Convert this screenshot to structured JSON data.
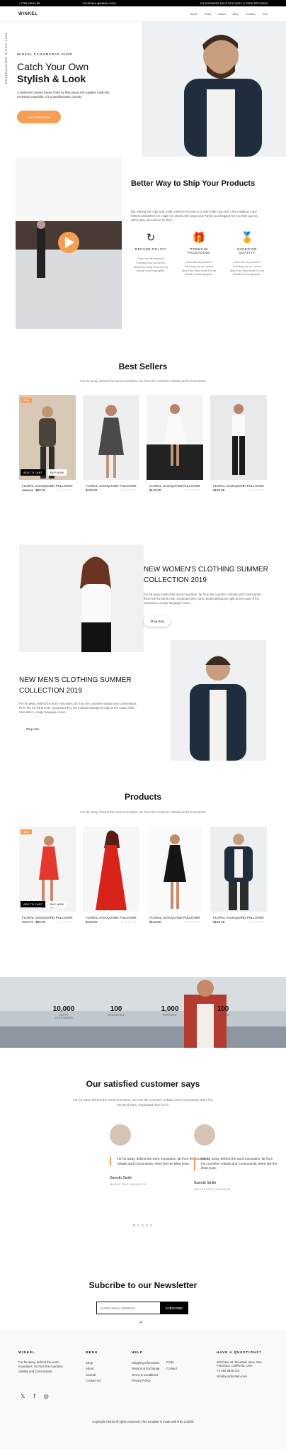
{
  "topbar": {
    "phone": "+ 2785 29910 88",
    "email": "YOURMAIL@EMAIL.COM",
    "offer": "3-5 BUSINESS DAYS DELIVERY & FREE RETURNS"
  },
  "nav": {
    "logo": "WINKEL",
    "items": [
      "Home",
      "Shop",
      "About",
      "Blog",
      "Contact",
      "Cart"
    ]
  },
  "hero": {
    "eyebrow": "WINKEL ECOMMERCE SHOP",
    "title1": "Catch Your Own",
    "title2": "Stylish & Look",
    "text": "A small river named Duden flows by their place and supplies it with the necessary regelialia. It is a paradisematic country.",
    "button": "DISCOVER NOW",
    "vertical": "ESTABLISHED SINCE 2000"
  },
  "ship": {
    "title": "Better Way to Ship Your Products",
    "text": "But nothing the copy said could convince her and so it didn't take long until a few insidious Copy Writers ambushed her, made her drunk with Longe and Parole and dragged her into their agency, where they abused her for their.",
    "features": [
      {
        "icon": "↻",
        "title": "REFUND POLICY",
        "text": "Even the all-powerful Pointing has no control about the blind texts it is an almost unorthographic."
      },
      {
        "icon": "🎁",
        "title": "PREMIUM PACKAGING",
        "text": "Even the all-powerful Pointing has no control about the blind texts it is an almost unorthographic."
      },
      {
        "icon": "🏅",
        "title": "SUPERIOR QUALITY",
        "text": "Even the all-powerful Pointing has no control about the blind texts it is an almost unorthographic."
      }
    ]
  },
  "bestsellers": {
    "title": "Best Sellers",
    "sub": "Far far away, behind the word mountains, far from the countries Vokalia and Consonantia",
    "products": [
      {
        "name": "FLORAL JACKQUARD PULLOVER",
        "old": "$120.00",
        "price": "$80.00",
        "badge": "30%",
        "cart": "ADD TO CART",
        "buy": "BUY NOW"
      },
      {
        "name": "FLORAL JACKQUARD PULLOVER",
        "old": "",
        "price": "$120.00",
        "badge": "",
        "cart": "",
        "buy": ""
      },
      {
        "name": "FLORAL JACKQUARD PULLOVER",
        "old": "",
        "price": "$120.00",
        "badge": "",
        "cart": "",
        "buy": ""
      },
      {
        "name": "FLORAL JACKQUARD PULLOVER",
        "old": "",
        "price": "$120.00",
        "badge": "",
        "cart": "",
        "buy": ""
      }
    ]
  },
  "women": {
    "title": "NEW WOMEN'S CLOTHING SUMMER COLLECTION 2019",
    "text": "Far far away, behind the word mountains, far from the countries Vokalia and Consonantia, there live the blind texts. Separated they live in Bookmarksgrove right at the coast of the Semantics, a large language ocean.",
    "button": "Shop Now"
  },
  "men": {
    "title": "NEW MEN'S CLOTHING SUMMER COLLECTION 2019",
    "text": "Far far away, behind the word mountains, far from the countries Vokalia and Consonantia, there live the blind texts. Separated they live in Bookmarksgrove right at the coast of the Semantics, a large language ocean.",
    "button": "Shop now"
  },
  "products": {
    "title": "Products",
    "sub": "Far far away, behind the word mountains, far from the countries Vokalia and Consonantia",
    "items": [
      {
        "name": "FLORAL JACKQUARD PULLOVER",
        "old": "$120.00",
        "price": "$80.00",
        "badge": "30%",
        "cart": "ADD TO CART",
        "buy": "BUY NOW"
      },
      {
        "name": "FLORAL JACKQUARD PULLOVER",
        "old": "",
        "price": "$120.00",
        "badge": "",
        "cart": "",
        "buy": ""
      },
      {
        "name": "FLORAL JACKQUARD PULLOVER",
        "old": "",
        "price": "$120.00",
        "badge": "",
        "cart": "",
        "buy": ""
      },
      {
        "name": "FLORAL JACKQUARD PULLOVER",
        "old": "",
        "price": "$120.00",
        "badge": "",
        "cart": "",
        "buy": ""
      }
    ]
  },
  "stats": [
    {
      "n": "10,000",
      "l": "HAPPY CUSTOMERS"
    },
    {
      "n": "100",
      "l": "BRANCHES"
    },
    {
      "n": "1,000",
      "l": "PARTNER"
    },
    {
      "n": "100",
      "l": "AWARDS"
    }
  ],
  "testimonials": {
    "title": "Our satisfied customer says",
    "sub": "Far far away, behind the word mountains, far from the countries Vokalia and Consonantia, there live the blind texts. Separated they live in",
    "items": [
      {
        "text": "Far far away, behind the word mountains, far from the countries Vokalia and Consonantia, there live the blind texts.",
        "name": "Garreth Smith",
        "role": "MARKETING MANAGER"
      },
      {
        "text": "Far far away, behind the word mountains, far from the countries Vokalia and Consonantia, there live the blind texts.",
        "name": "Garreth Smith",
        "role": "INTERFACE DESIGNER"
      }
    ]
  },
  "newsletter": {
    "title": "Subcribe to our Newsletter",
    "placeholder": "ENTER EMAIL ADDRESS",
    "button": "SUBSCRIBE"
  },
  "footer": {
    "brand": "WINKEL",
    "about": "Far far away, behind the word mountains, far from the countries Vokalia and Consonantia.",
    "menu_h": "MENU",
    "menu": [
      "Shop",
      "About",
      "Journal",
      "Contact Us"
    ],
    "help_h": "HELP",
    "help1": [
      "Shipping Information",
      "Returns & Exchange",
      "Terms & Conditions",
      "Privacy Policy"
    ],
    "help2": [
      "FAQs",
      "Contact"
    ],
    "q_h": "HAVE A QUESTIONS?",
    "q": [
      "203 Fake St. Mountain View, San Francisco, California, USA",
      "+2 392 3929 210",
      "info@yourdomain.com"
    ],
    "copyright": "Copyright ©2019 All rights reserved | This template is made with ♥ by Colorlib"
  },
  "colors": {
    "accent": "#f59e55",
    "dark": "#111111"
  }
}
